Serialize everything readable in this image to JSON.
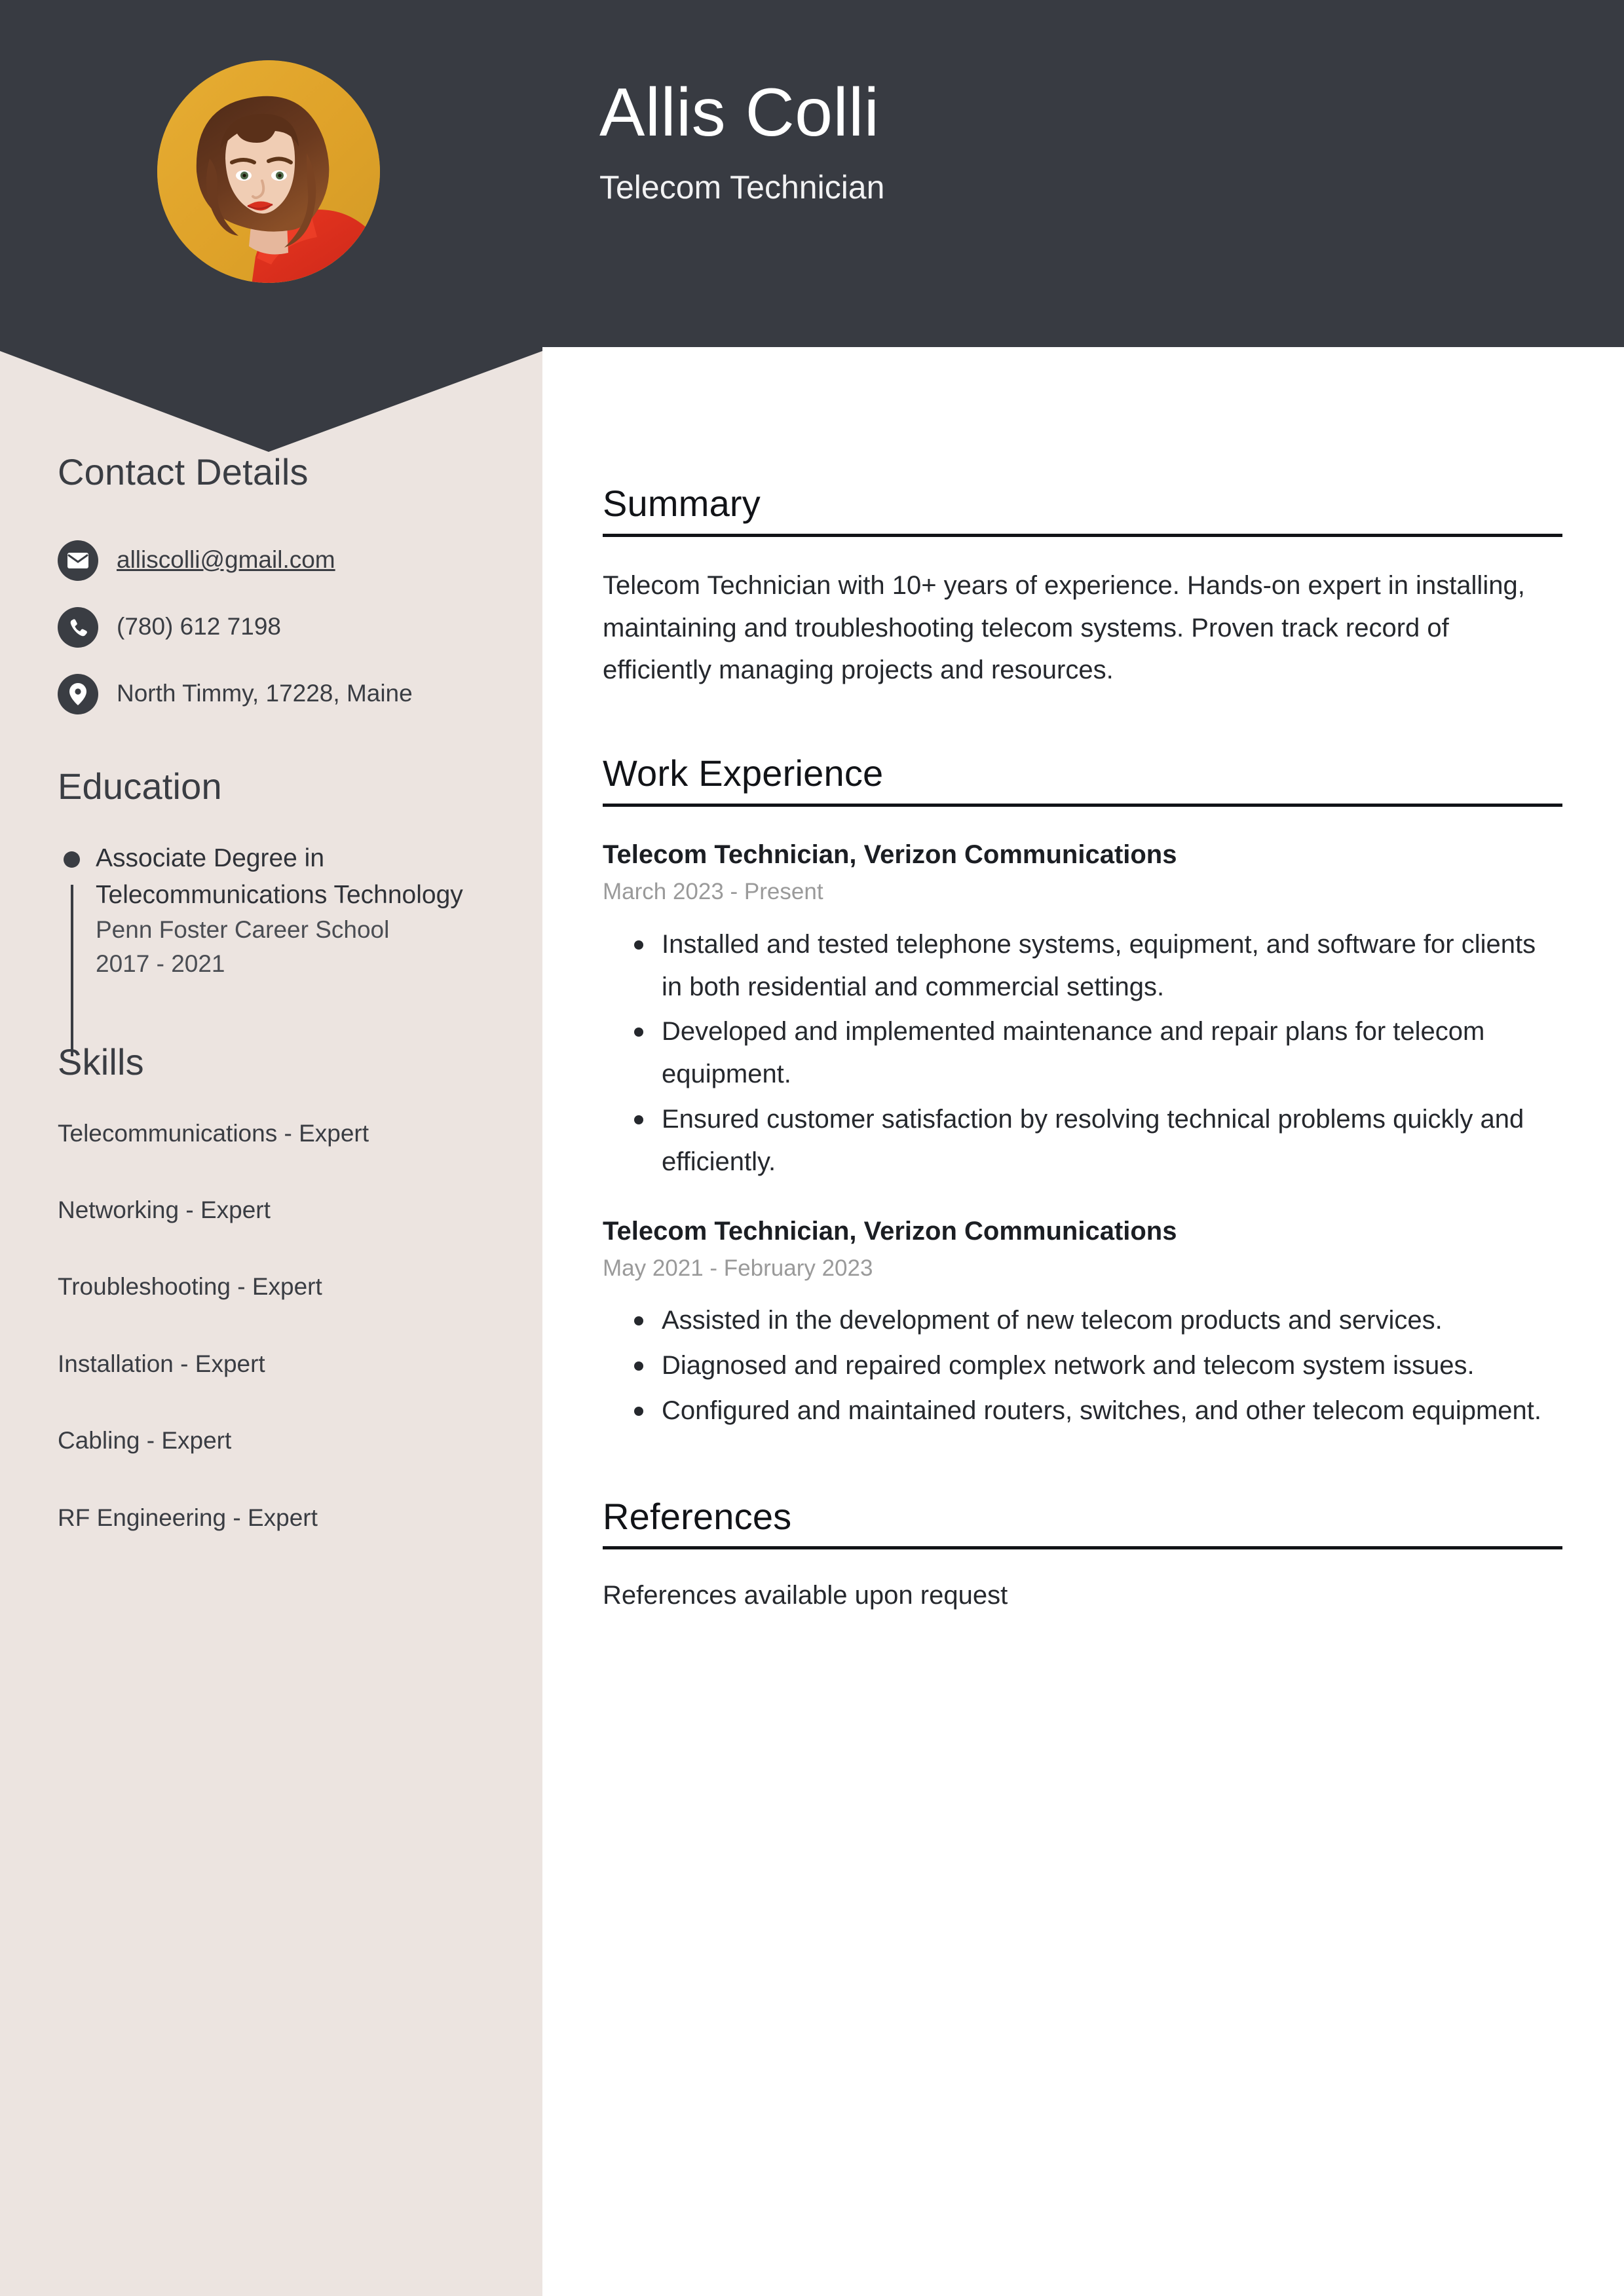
{
  "theme": {
    "header_bg": "#383b42",
    "sidebar_bg": "#ece4e0",
    "main_bg": "#ffffff",
    "text_dark": "#3a3d43",
    "muted_date": "#9a9a9a",
    "photo_bg": "#e0a62c"
  },
  "header": {
    "name": "Allis Colli",
    "job_title": "Telecom Technician",
    "avatar_alt": "portrait-photo"
  },
  "sidebar": {
    "contact": {
      "heading": "Contact Details",
      "items": [
        {
          "icon": "envelope-icon",
          "value": "alliscolli@gmail.com",
          "link": true
        },
        {
          "icon": "phone-icon",
          "value": "(780) 612 7198",
          "link": false
        },
        {
          "icon": "location-pin-icon",
          "value": "North Timmy, 17228, Maine",
          "link": false
        }
      ]
    },
    "education": {
      "heading": "Education",
      "items": [
        {
          "degree": "Associate Degree in Telecommunications Technology",
          "school": "Penn Foster Career School",
          "dates": "2017 - 2021"
        }
      ]
    },
    "skills": {
      "heading": "Skills",
      "items": [
        "Telecommunications - Expert",
        "Networking - Expert",
        "Troubleshooting - Expert",
        "Installation - Expert",
        "Cabling - Expert",
        "RF Engineering - Expert"
      ]
    }
  },
  "main": {
    "summary": {
      "heading": "Summary",
      "text": "Telecom Technician with 10+ years of experience. Hands-on expert in installing, maintaining and troubleshooting telecom systems. Proven track record of efficiently managing projects and resources."
    },
    "work_experience": {
      "heading": "Work Experience",
      "jobs": [
        {
          "title": "Telecom Technician, Verizon Communications",
          "dates": "March 2023 - Present",
          "bullets": [
            "Installed and tested telephone systems, equipment, and software for clients in both residential and commercial settings.",
            "Developed and implemented maintenance and repair plans for telecom equipment.",
            "Ensured customer satisfaction by resolving technical problems quickly and efficiently."
          ]
        },
        {
          "title": "Telecom Technician, Verizon Communications",
          "dates": "May 2021 - February 2023",
          "bullets": [
            "Assisted in the development of new telecom products and services.",
            "Diagnosed and repaired complex network and telecom system issues.",
            "Configured and maintained routers, switches, and other telecom equipment."
          ]
        }
      ]
    },
    "references": {
      "heading": "References",
      "text": "References available upon request"
    }
  }
}
